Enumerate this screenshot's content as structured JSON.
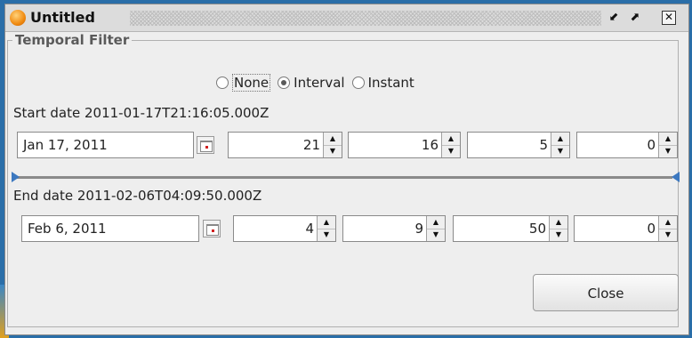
{
  "window": {
    "title": "Untitled",
    "min_glyph": "⬋",
    "max_glyph": "⬈",
    "close_glyph": "✕"
  },
  "panel": {
    "legend": "Temporal Filter"
  },
  "filter_mode": {
    "options": [
      {
        "label": "None",
        "selected": false
      },
      {
        "label": "Interval",
        "selected": true
      },
      {
        "label": "Instant",
        "selected": false
      }
    ]
  },
  "start": {
    "label": "Start date 2011-01-17T21:16:05.000Z",
    "date": "Jan 17, 2011",
    "hour": "21",
    "minute": "16",
    "second": "5",
    "millis": "0"
  },
  "end": {
    "label": "End date 2011-02-06T04:09:50.000Z",
    "date": "Feb 6, 2011",
    "hour": "4",
    "minute": "9",
    "second": "50",
    "millis": "0"
  },
  "spinner": {
    "up_glyph": "▲",
    "down_glyph": "▼"
  },
  "buttons": {
    "close_label": "Close"
  },
  "colors": {
    "slider_thumb": "#3c78c0",
    "title_logo": "#f08a10"
  }
}
